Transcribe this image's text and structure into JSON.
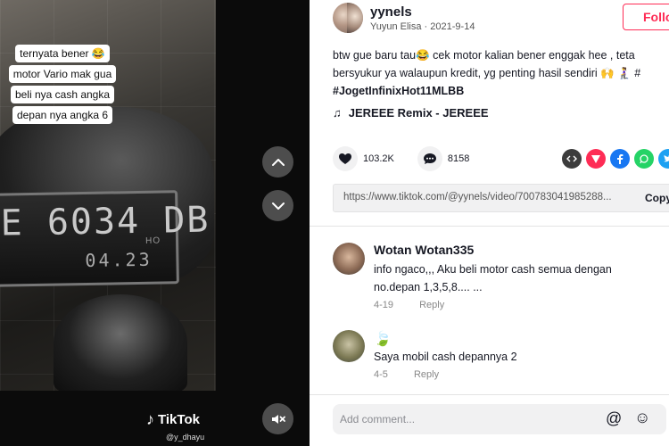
{
  "video": {
    "caption_lines": [
      "ternyata bener 😂",
      "motor Vario mak gua",
      "beli nya cash angka",
      "depan nya angka 6"
    ],
    "plate_number": "E 6034 DB",
    "plate_expiry": "04.23",
    "brand_mark": "HO",
    "watermark_logo": "TikTok",
    "watermark_handle": "@y_dhayu"
  },
  "author": {
    "username": "yynels",
    "display_name": "Yuyun Elisa",
    "separator": "·",
    "date": "2021-9-14",
    "follow_label": "Follo"
  },
  "description": {
    "line1": "btw gue baru tau😂 cek motor kalian bener enggak hee , teta",
    "line2": "bersyukur ya walaupun kredit, yg penting hasil sendiri 🙌 🧎‍♀️ #",
    "hashtag": "#JogetInfinixHot11MLBB"
  },
  "music": {
    "title": "JEREEE Remix - JEREEE"
  },
  "stats": {
    "likes": "103.2K",
    "comments": "8158"
  },
  "share": {
    "colors": {
      "embed": "#3c3c3c",
      "send": "#fe2c55",
      "facebook": "#1877f2",
      "whatsapp": "#25d366",
      "twitter": "#1da1f2"
    }
  },
  "link": {
    "url": "https://www.tiktok.com/@yynels/video/700783041985288...",
    "copy_label": "Copy"
  },
  "comments": [
    {
      "name": "Wotan Wotan335",
      "text_line1": "info ngaco,,, Aku beli motor cash semua dengan",
      "text_line2": "no.depan 1,3,5,8.... ...",
      "date": "4-19",
      "reply": "Reply"
    },
    {
      "name": "🍃",
      "text_line1": "Saya mobil cash depannya 2",
      "date": "4-5",
      "reply": "Reply"
    }
  ],
  "comment_box": {
    "placeholder": "Add comment..."
  }
}
